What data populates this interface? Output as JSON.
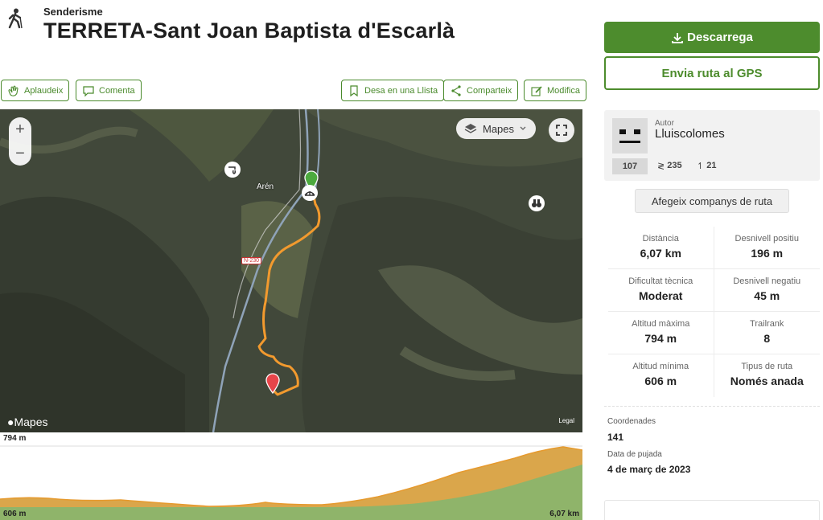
{
  "header": {
    "activity_type": "Senderisme",
    "title": "TERRETA-Sant Joan Baptista d'Escarlà",
    "activity_icon": "hiker-icon"
  },
  "actions": {
    "applaud": "Aplaudeix",
    "comment": "Comenta",
    "save_list": "Desa en una Llista",
    "share": "Comparteix",
    "edit": "Modifica"
  },
  "map": {
    "map_type": "Mapes",
    "brand": "Mapes",
    "legal": "Legal",
    "town": "Arén",
    "road": "N-230",
    "zoom_in": "+",
    "zoom_out": "−"
  },
  "elevation": {
    "max": "794 m",
    "min": "606 m",
    "distance": "6,07 km"
  },
  "sidebar": {
    "download": "Descarrega",
    "send_gps": "Envia ruta al GPS",
    "author_label": "Autor",
    "author_name": "Lluiscolomes",
    "rank": "107",
    "stat_trails": "235",
    "stat_followers": "21",
    "add_companions": "Afegeix companys de ruta"
  },
  "stats": [
    [
      {
        "label": "Distància",
        "value": "6,07 km"
      },
      {
        "label": "Desnivell positiu",
        "value": "196 m"
      }
    ],
    [
      {
        "label": "Dificultat tècnica",
        "value": "Moderat"
      },
      {
        "label": "Desnivell negatiu",
        "value": "45 m"
      }
    ],
    [
      {
        "label": "Altitud màxima",
        "value": "794 m"
      },
      {
        "label": "Trailrank",
        "value": "8"
      }
    ],
    [
      {
        "label": "Altitud mínima",
        "value": "606 m"
      },
      {
        "label": "Tipus de ruta",
        "value": "Només anada"
      }
    ]
  ],
  "meta": {
    "coords_label": "Coordenades",
    "coords_value": "141",
    "upload_label": "Data de pujada",
    "upload_value": "4 de març de 2023"
  },
  "colors": {
    "brand_green": "#4d8c2d",
    "route_orange": "#f29a2e",
    "elevation_fill": "#8fb46a"
  }
}
